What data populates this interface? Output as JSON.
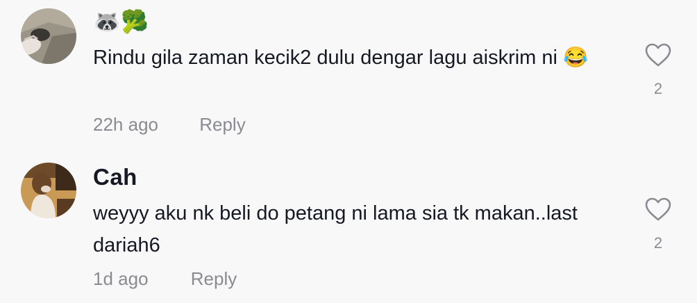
{
  "comments": [
    {
      "username": "🦝🥦",
      "text": "Rindu gila zaman kecik2 dulu dengar lagu aiskrim ni 😂",
      "time": "22h ago",
      "reply_label": "Reply",
      "like_count": "2",
      "like_icon": "heart-outline-icon"
    },
    {
      "username": "Cah",
      "text": "weyyy aku nk beli do petang ni lama sia tk makan..last dariah6",
      "time": "1d ago",
      "reply_label": "Reply",
      "like_count": "2",
      "like_icon": "heart-outline-icon"
    }
  ],
  "colors": {
    "background": "#f8f8f8",
    "text": "#161823",
    "muted": "#8a8b91"
  }
}
